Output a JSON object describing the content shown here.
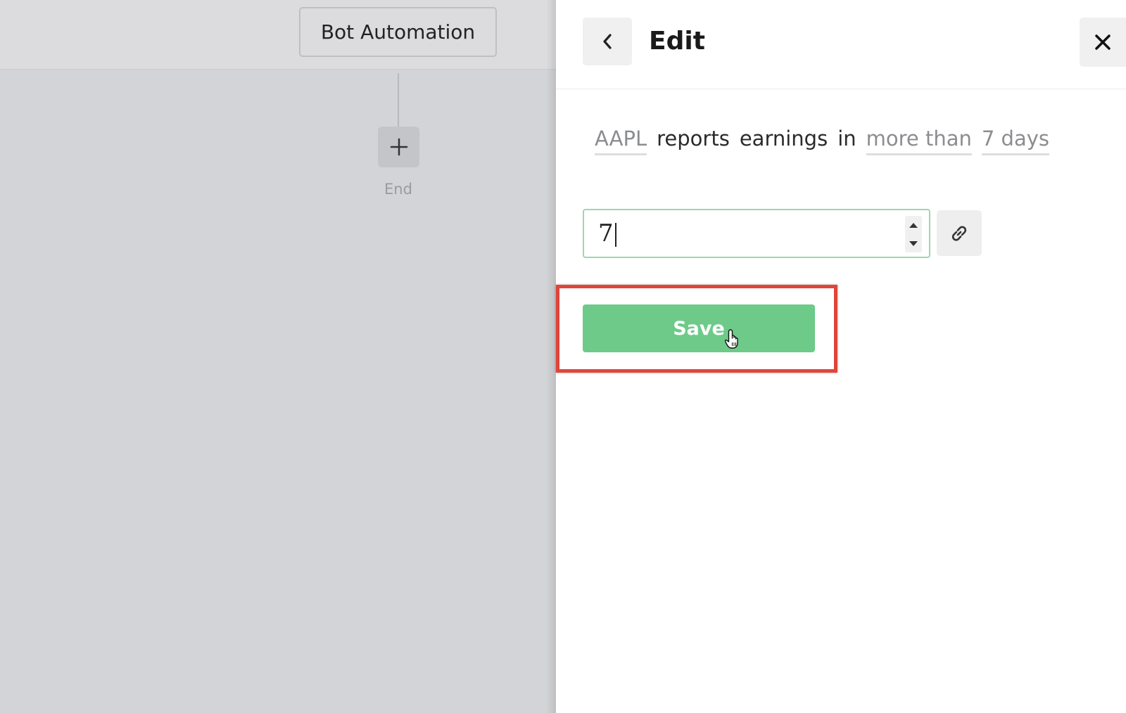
{
  "canvas": {
    "trigger_node_label": "Bot Automation",
    "add_button_symbol": "+",
    "end_label": "End"
  },
  "panel": {
    "title": "Edit",
    "back_icon": "chevron-left-icon",
    "close_icon": "close-icon",
    "sentence": {
      "ticker": "AAPL",
      "text_1": "reports",
      "text_2": "earnings",
      "text_3": "in",
      "comparator": "more than",
      "duration": "7 days"
    },
    "number_input": {
      "value": "7"
    },
    "link_icon": "link-icon",
    "save_label": "Save"
  },
  "colors": {
    "save_button": "#6dca89",
    "input_border": "#9ed6b3",
    "highlight": "#e0453a",
    "canvas_bg": "#d3d4d7"
  }
}
